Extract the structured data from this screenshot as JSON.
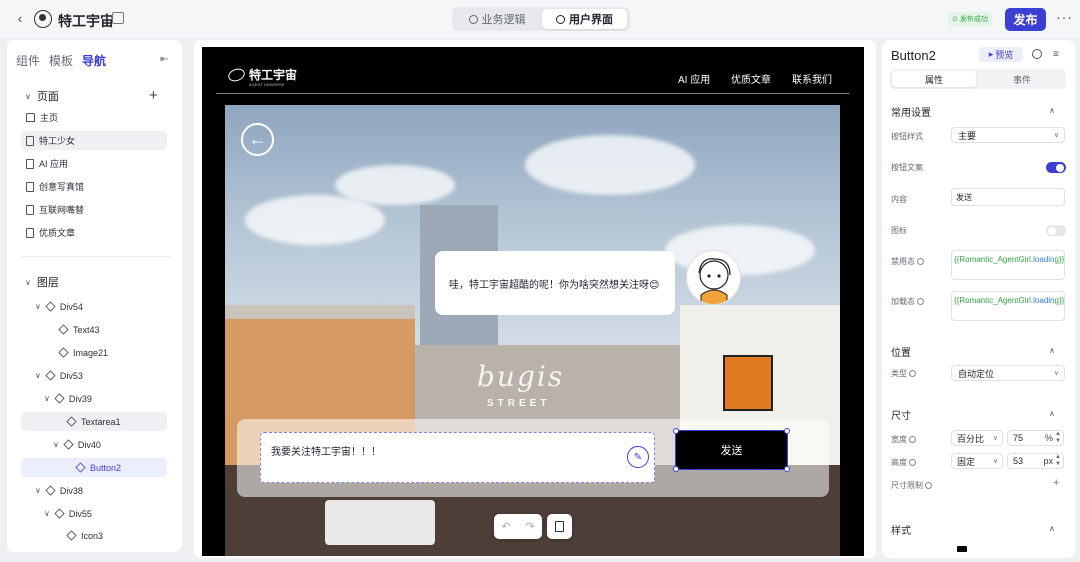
{
  "topbar": {
    "title": "特工宇宙",
    "modes": {
      "logic": "业务逻辑",
      "ui": "用户界面"
    },
    "status": "发布成功",
    "publish": "发布",
    "more": "···"
  },
  "left": {
    "tabs": [
      "组件",
      "模板",
      "导航"
    ],
    "active_tab": "导航",
    "pages_title": "页面",
    "pages": [
      "主页",
      "特工少女",
      "AI 应用",
      "创意写真馆",
      "互联网嘴替",
      "优质文章"
    ],
    "layers_title": "图层",
    "layers": [
      {
        "name": "Div54",
        "depth": 1
      },
      {
        "name": "Text43",
        "depth": 2
      },
      {
        "name": "Image21",
        "depth": 2
      },
      {
        "name": "Div53",
        "depth": 1
      },
      {
        "name": "Div39",
        "depth": 2
      },
      {
        "name": "Textarea1",
        "depth": 3
      },
      {
        "name": "Div40",
        "depth": 3
      },
      {
        "name": "Button2",
        "depth": 4
      },
      {
        "name": "Div38",
        "depth": 1
      },
      {
        "name": "Div55",
        "depth": 2
      },
      {
        "name": "Icon3",
        "depth": 3
      }
    ]
  },
  "site": {
    "logo": "特工宇宙",
    "logo_sub": "AGENT UNIVERSE",
    "nav": [
      "AI 应用",
      "优质文章",
      "联系我们"
    ],
    "bubble": "哇，特工宇宙超酷的呢！你为啥突然想关注呀😊",
    "sign": "bugis",
    "sign_sub": "STREET",
    "input_text": "我要关注特工宇宙！！！",
    "send": "发送"
  },
  "right": {
    "title": "Button2",
    "preview": "预览",
    "tabs": [
      "属性",
      "事件"
    ],
    "common": "常用设置",
    "button_style_label": "按钮样式",
    "button_style": "主要",
    "button_text_label": "按钮文案",
    "content_label": "内容",
    "content": "发送",
    "icon_label": "图标",
    "disabled_label": "禁用态",
    "disabled_value_pre": "{{Romantic_AgentGirl.",
    "disabled_value_key": "loadin",
    "disabled_value_post": "g}}",
    "loading_label": "加载态",
    "loading_value_pre": "{{Romantic_AgentGirl.",
    "loading_value_key": "loadin",
    "loading_value_post": "g}}",
    "position": "位置",
    "type_label": "类型",
    "type_value": "自动定位",
    "size": "尺寸",
    "width_label": "宽度",
    "width_unit": "百分比",
    "width_value": "75",
    "width_suffix": "%",
    "height_label": "高度",
    "height_unit": "固定",
    "height_value": "53",
    "height_suffix": "px",
    "size_limit": "尺寸限制",
    "style": "样式"
  }
}
